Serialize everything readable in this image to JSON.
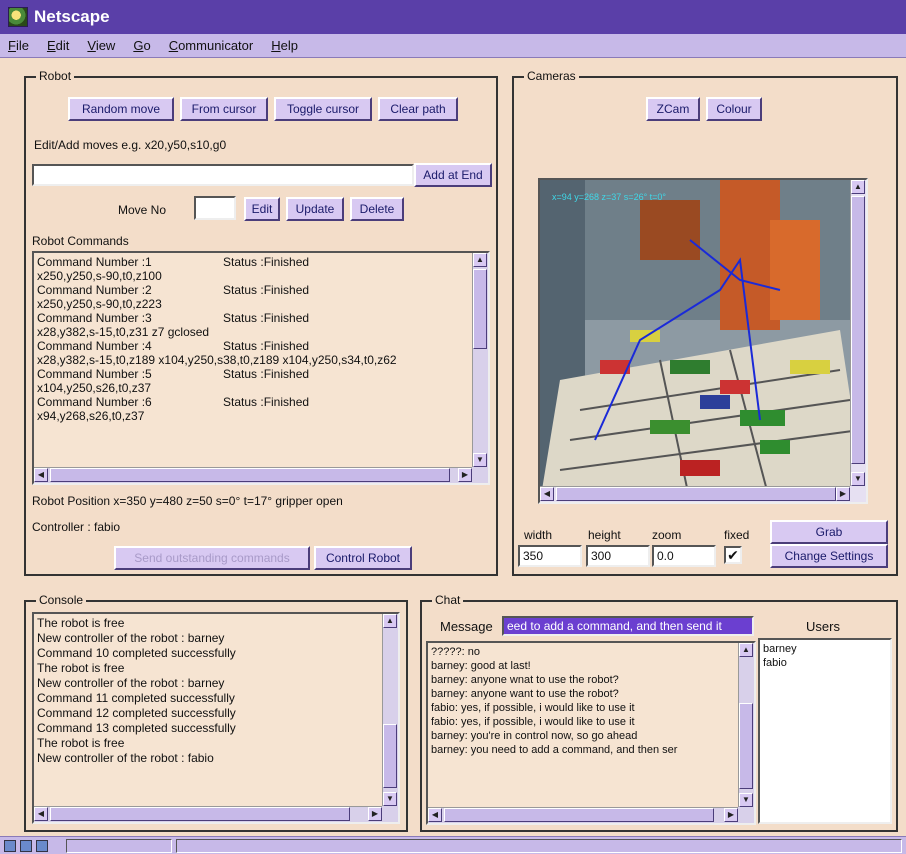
{
  "window": {
    "title": "Netscape"
  },
  "menu": [
    "File",
    "Edit",
    "View",
    "Go",
    "Communicator",
    "Help"
  ],
  "robot": {
    "legend": "Robot",
    "buttons": {
      "random_move": "Random move",
      "from_cursor": "From cursor",
      "toggle_cursor": "Toggle cursor",
      "clear_path": "Clear path"
    },
    "edit_hint": "Edit/Add moves e.g. x20,y50,s10,g0",
    "add_input_value": "",
    "add_at_end": "Add at End",
    "move_no_label": "Move No",
    "move_no_value": "",
    "edit": "Edit",
    "update": "Update",
    "delete": "Delete",
    "commands_label": "Robot Commands",
    "commands": [
      {
        "head": "Command Number :1",
        "status": "Status :Finished",
        "detail": "x250,y250,s-90,t0,z100"
      },
      {
        "head": "Command Number :2",
        "status": "Status :Finished",
        "detail": "x250,y250,s-90,t0,z223"
      },
      {
        "head": "Command Number :3",
        "status": "Status :Finished",
        "detail": "x28,y382,s-15,t0,z31 z7 gclosed"
      },
      {
        "head": "Command Number :4",
        "status": "Status :Finished",
        "detail": "x28,y382,s-15,t0,z189 x104,y250,s38,t0,z189 x104,y250,s34,t0,z62"
      },
      {
        "head": "Command Number :5",
        "status": "Status :Finished",
        "detail": "x104,y250,s26,t0,z37"
      },
      {
        "head": "Command Number :6",
        "status": "Status :Finished",
        "detail": "x94,y268,s26,t0,z37"
      }
    ],
    "position": "Robot Position  x=350 y=480 z=50 s=0° t=17° gripper open",
    "controller": "Controller : fabio",
    "send_outstanding": "Send outstanding commands",
    "control_robot": "Control Robot"
  },
  "cameras": {
    "legend": "Cameras",
    "zcam": "ZCam",
    "colour": "Colour",
    "overlay": "x=94 y=268 z=37 s=26° t=0°",
    "width_label": "width",
    "height_label": "height",
    "zoom_label": "zoom",
    "fixed_label": "fixed",
    "width_value": "350",
    "height_value": "300",
    "zoom_value": "0.0",
    "fixed_checked": "✔",
    "grab": "Grab",
    "change_settings": "Change Settings"
  },
  "console": {
    "legend": "Console",
    "lines": [
      "The robot is free",
      "New controller of the robot : barney",
      "Command 10 completed successfully",
      "The robot is free",
      "New controller of the robot : barney",
      "Command 11 completed successfully",
      "Command 12 completed successfully",
      "Command 13 completed successfully",
      "The robot is free",
      "New controller of the robot : fabio"
    ]
  },
  "chat": {
    "legend": "Chat",
    "message_label": "Message",
    "message_value": "eed to add a command, and then send it",
    "users_label": "Users",
    "users": [
      "barney",
      "fabio"
    ],
    "lines": [
      "?????: no",
      "barney: good at last!",
      "barney: anyone wnat to use the robot?",
      "barney: anyone want to use the robot?",
      "fabio: yes, if possible, i would like to use it",
      "fabio: yes, if possible, i would like to use it",
      "barney: you're in control now,  so go ahead",
      "barney: you need to add a command, and then ser"
    ]
  }
}
